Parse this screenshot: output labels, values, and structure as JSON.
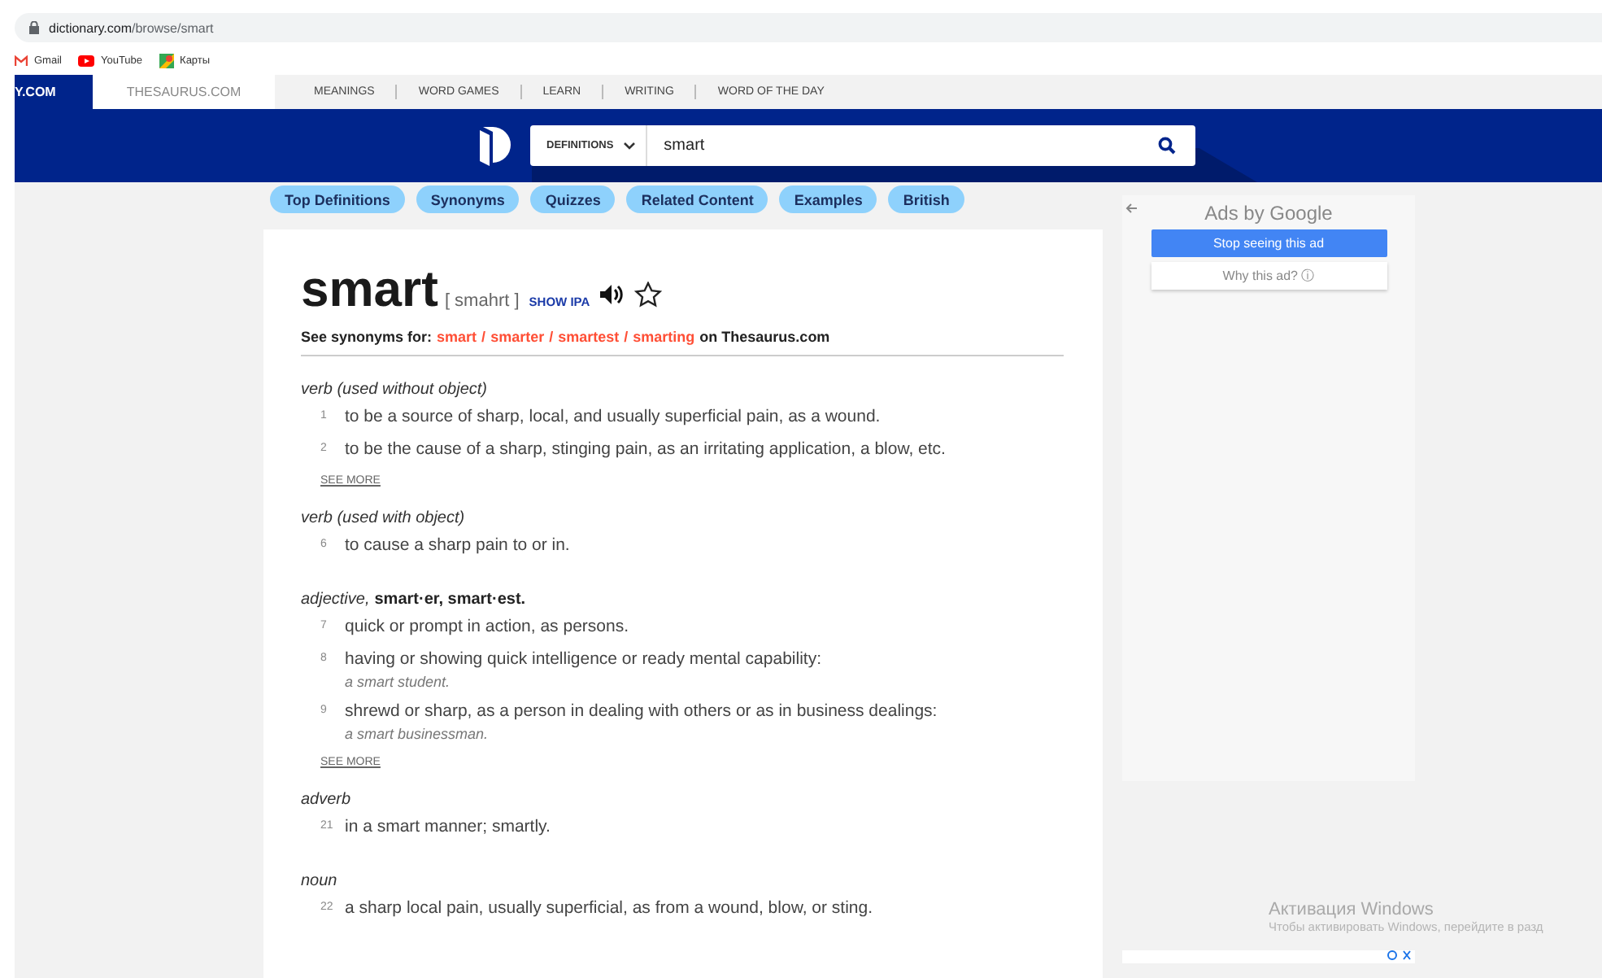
{
  "browser": {
    "url_host": "dictionary.com",
    "url_path": "/browse/smart",
    "bookmarks": [
      {
        "label": "Gmail",
        "kind": "gmail"
      },
      {
        "label": "YouTube",
        "kind": "youtube"
      },
      {
        "label": "Карты",
        "kind": "maps"
      }
    ]
  },
  "site_nav": {
    "tabs": [
      {
        "label": "Y.COM",
        "selected": true
      },
      {
        "label": "THESAURUS.COM",
        "selected": false
      }
    ],
    "links": [
      "MEANINGS",
      "WORD GAMES",
      "LEARN",
      "WRITING",
      "WORD OF THE DAY"
    ]
  },
  "search": {
    "dropdown": "DEFINITIONS",
    "value": "smart"
  },
  "section_pills": [
    "Top Definitions",
    "Synonyms",
    "Quizzes",
    "Related Content",
    "Examples",
    "British"
  ],
  "entry": {
    "headword": "smart",
    "pronunciation": "[ smahrt ]",
    "show_ipa": "SHOW IPA",
    "synonyms": {
      "prefix": "See synonyms for:",
      "links": [
        "smart",
        "smarter",
        "smartest",
        "smarting"
      ],
      "separator": "/",
      "suffix": "on Thesaurus.com"
    },
    "sections": [
      {
        "pos": "verb (used without object)",
        "definitions": [
          {
            "number": "1",
            "text": "to be a source of sharp, local, and usually superficial pain, as a wound."
          },
          {
            "number": "2",
            "text": "to be the cause of a sharp, stinging pain, as an irritating application, a blow, etc."
          }
        ],
        "see_more": "SEE MORE"
      },
      {
        "pos": "verb (used with object)",
        "definitions": [
          {
            "number": "6",
            "text": "to cause a sharp pain to or in."
          }
        ]
      },
      {
        "pos": "adjective,",
        "forms": "smart·er, smart·est.",
        "definitions": [
          {
            "number": "7",
            "text": "quick or prompt in action, as persons."
          },
          {
            "number": "8",
            "text": "having or showing quick intelligence or ready mental capability:",
            "example": "a smart student."
          },
          {
            "number": "9",
            "text": "shrewd or sharp, as a person in dealing with others or as in business dealings:",
            "example": "a smart businessman."
          }
        ],
        "see_more": "SEE MORE"
      },
      {
        "pos": "adverb",
        "definitions": [
          {
            "number": "21",
            "text": "in a smart manner; smartly."
          }
        ]
      },
      {
        "pos": "noun",
        "definitions": [
          {
            "number": "22",
            "text": "a sharp local pain, usually superficial, as from a wound, blow, or sting."
          }
        ]
      }
    ]
  },
  "ad": {
    "title": "Ads by Google",
    "stop_button": "Stop seeing this ad",
    "why_button": "Why this ad? ⓘ"
  },
  "os_notice": {
    "title": "Активация Windows",
    "text": "Чтобы активировать Windows, перейдите в разд"
  }
}
